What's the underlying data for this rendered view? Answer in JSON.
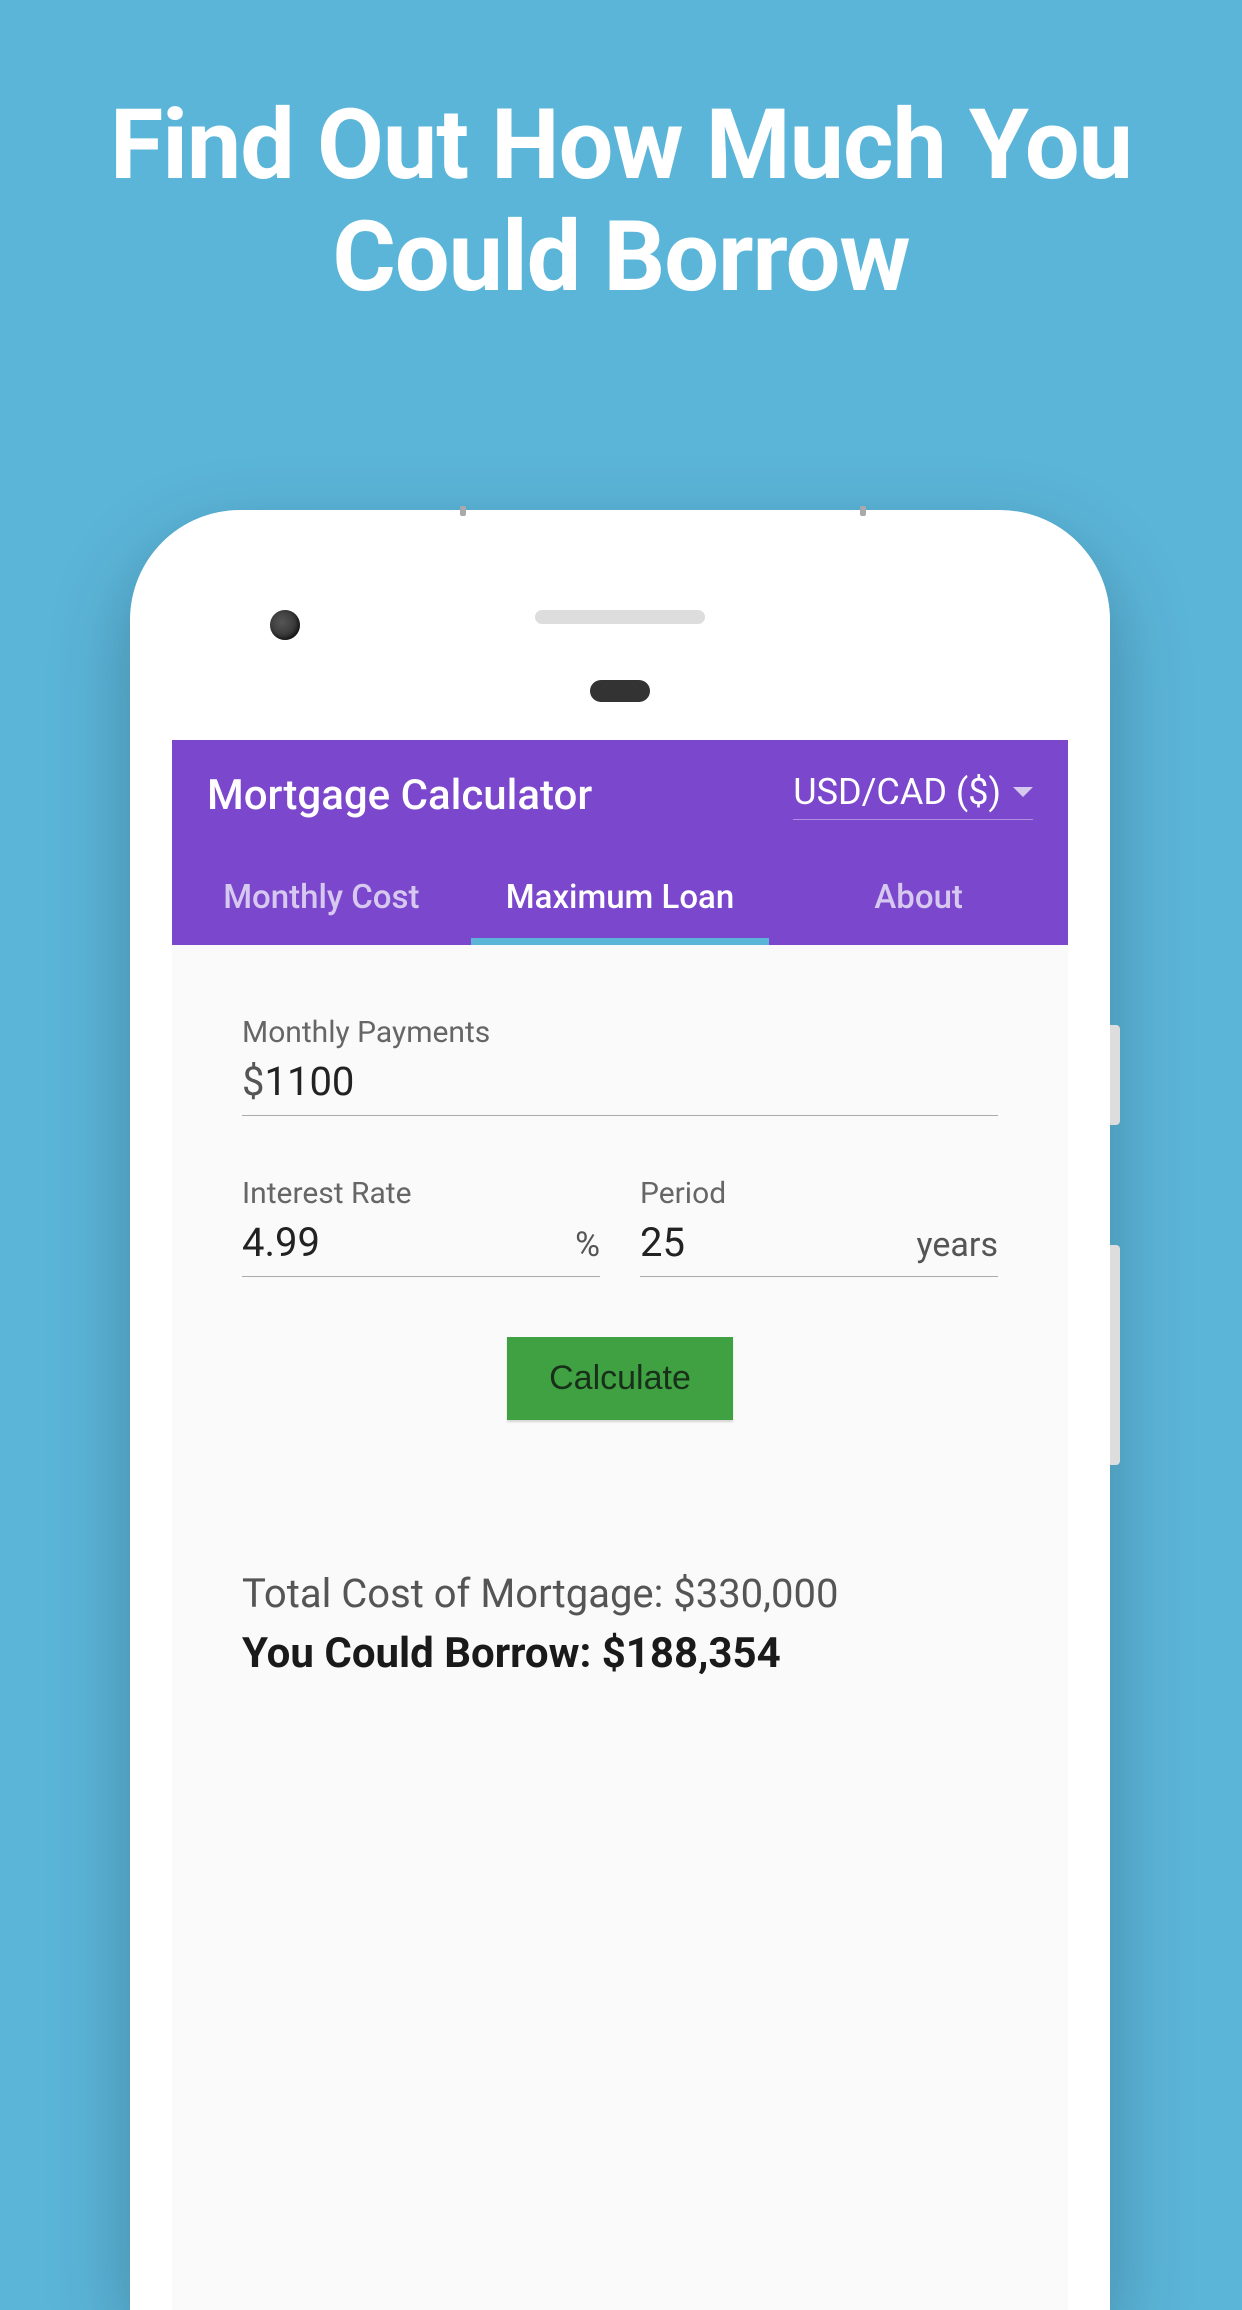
{
  "marketing": {
    "headline": "Find Out How Much You Could Borrow"
  },
  "app": {
    "title": "Mortgage Calculator",
    "currency_selected": "USD/CAD ($)"
  },
  "tabs": {
    "monthly_cost": "Monthly Cost",
    "maximum_loan": "Maximum Loan",
    "about": "About"
  },
  "fields": {
    "monthly_payments": {
      "label": "Monthly Payments",
      "prefix": "$",
      "value": "1100"
    },
    "interest_rate": {
      "label": "Interest Rate",
      "value": "4.99",
      "suffix": "%"
    },
    "period": {
      "label": "Period",
      "value": "25",
      "suffix": "years"
    }
  },
  "actions": {
    "calculate": "Calculate"
  },
  "results": {
    "total_cost": "Total Cost of Mortgage: $330,000",
    "could_borrow": "You Could Borrow: $188,354"
  }
}
